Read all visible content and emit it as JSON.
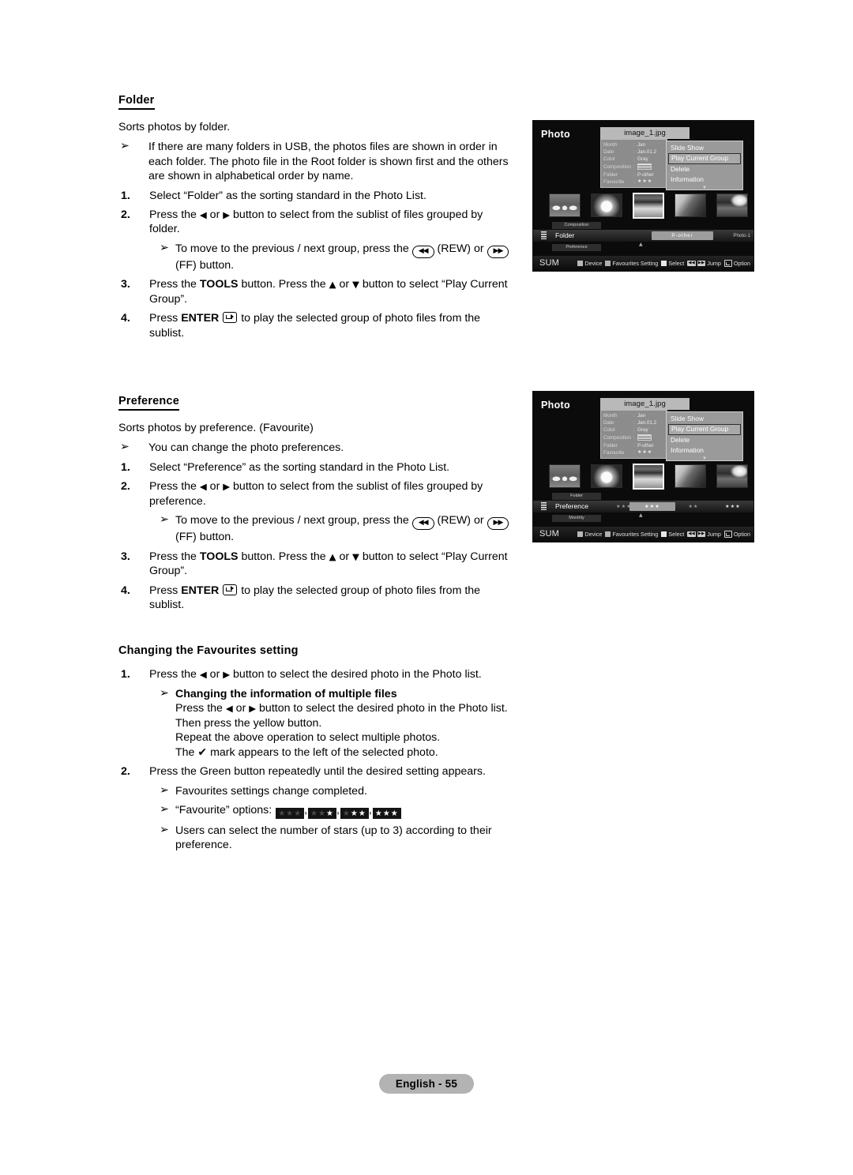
{
  "page": {
    "footer_label": "English - 55"
  },
  "folder_section": {
    "heading": "Folder",
    "lead": "Sorts photos by folder.",
    "note": "If there are many folders in USB, the photos files are shown in order in each folder. The photo file in the Root folder is shown first and the others are shown in alphabetical order by name.",
    "step1_num": "1.",
    "step1": "Select “Folder” as the sorting standard in the Photo List.",
    "step2_num": "2.",
    "step2_a": "Press the ",
    "step2_b": " or ",
    "step2_c": " button to select from the sublist of files grouped by folder.",
    "substep_a": "To move to the previous / next group, press the ",
    "substep_rew": "(REW) or ",
    "substep_ff": "(FF) button.",
    "step3_num": "3.",
    "step3_a": "Press the ",
    "step3_tools": "TOOLS",
    "step3_b": " button. Press the ",
    "step3_c": " or ",
    "step3_d": " button to select “Play Current Group”.",
    "step4_num": "4.",
    "step4_a": "Press ",
    "step4_enter": "ENTER",
    "step4_b": " to play the selected group of photo files from the sublist."
  },
  "preference_section": {
    "heading": "Preference",
    "lead": "Sorts photos by preference. (Favourite)",
    "note": "You can change the photo preferences.",
    "step1_num": "1.",
    "step1": "Select “Preference” as the sorting standard in the Photo List.",
    "step2_num": "2.",
    "step2_a": "Press the ",
    "step2_b": " or ",
    "step2_c": " button to select from the sublist of files grouped by preference.",
    "substep_a": "To move to the previous / next group, press the ",
    "substep_rew": "(REW) or ",
    "substep_ff": "(FF) button.",
    "step3_num": "3.",
    "step3_a": "Press the ",
    "step3_tools": "TOOLS",
    "step3_b": " button. Press the ",
    "step3_c": " or ",
    "step3_d": " button to select “Play Current Group”.",
    "step4_num": "4.",
    "step4_a": "Press ",
    "step4_enter": "ENTER",
    "step4_b": " to play the selected group of photo files from the sublist."
  },
  "favourites_section": {
    "heading": "Changing the Favourites setting",
    "step1_num": "1.",
    "step1_a": "Press the ",
    "step1_b": " or ",
    "step1_c": " button to select the desired photo in the Photo list.",
    "sub_heading": "Changing the information of multiple files",
    "sub_line1_a": "Press the ",
    "sub_line1_b": " or ",
    "sub_line1_c": " button to select the desired photo in the Photo list.",
    "sub_line2": "Then press the yellow button.",
    "sub_line3": "Repeat the above operation to select multiple photos.",
    "sub_line4_a": "The ",
    "sub_line4_b": " mark appears to the left of the selected photo.",
    "step2_num": "2.",
    "step2": "Press the Green button repeatedly until the desired setting appears.",
    "note1": "Favourites settings change completed.",
    "note2_label": "“Favourite” options:",
    "fav_options": [
      {
        "filled": 0,
        "total": 3
      },
      {
        "filled": 1,
        "total": 3
      },
      {
        "filled": 2,
        "total": 3
      },
      {
        "filled": 3,
        "total": 3
      }
    ],
    "note3": "Users can select the number of stars (up to 3) according to their preference."
  },
  "tv_screens": [
    {
      "id": "folder-screen",
      "title": "Photo",
      "file_name": "image_1.jpg",
      "info": [
        {
          "key": "Month",
          "sep": ":",
          "value": "Jan"
        },
        {
          "key": "Date",
          "sep": ":",
          "value": "Jan.01.2"
        },
        {
          "key": "Color",
          "sep": ":",
          "value": "Gray"
        },
        {
          "key": "Composition",
          "sep": ":",
          "value": ""
        },
        {
          "key": "Folder",
          "sep": ":",
          "value": "P-other"
        },
        {
          "key": "Favourite",
          "sep": ":",
          "value": "★★★"
        }
      ],
      "menu": {
        "items": [
          "Slide Show",
          "Play Current Group",
          "Delete",
          "Information"
        ],
        "selected": "Play Current Group",
        "more_glyph": "▼"
      },
      "sortbar": {
        "above_label": "Composition",
        "current_label": "Folder",
        "below_label": "Preference",
        "cells": [
          {
            "text": "",
            "highlight": false
          },
          {
            "text": "P-other",
            "highlight": true
          },
          {
            "text": "",
            "highlight": false
          }
        ],
        "right_label": "Photo-1",
        "caret": "▲"
      },
      "footer": {
        "sum": "SUM",
        "keys": [
          {
            "swatch": "red",
            "label": "Device"
          },
          {
            "swatch": "green",
            "label": "Favourites Setting"
          },
          {
            "swatch": "yellow",
            "label": "Select"
          },
          {
            "swatch": "jump",
            "label": "Jump"
          },
          {
            "swatch": "option",
            "label": "Option"
          }
        ]
      }
    },
    {
      "id": "preference-screen",
      "title": "Photo",
      "file_name": "image_1.jpg",
      "info": [
        {
          "key": "Month",
          "sep": ":",
          "value": "Jan"
        },
        {
          "key": "Date",
          "sep": ":",
          "value": "Jan.01.2"
        },
        {
          "key": "Color",
          "sep": ":",
          "value": "Gray"
        },
        {
          "key": "Composition",
          "sep": ":",
          "value": ""
        },
        {
          "key": "Folder",
          "sep": ":",
          "value": "P-other"
        },
        {
          "key": "Favourite",
          "sep": ":",
          "value": "★★★"
        }
      ],
      "menu": {
        "items": [
          "Slide Show",
          "Play Current Group",
          "Delete",
          "Information"
        ],
        "selected": "Play Current Group",
        "more_glyph": "▼"
      },
      "sortbar": {
        "above_label": "Folder",
        "current_label": "Preference",
        "below_label": "Monthly",
        "cells": [
          {
            "text": "★★★",
            "highlight": false
          },
          {
            "text": "★★★",
            "highlight": true
          },
          {
            "text": "★★",
            "highlight": false
          },
          {
            "text": "★★★",
            "highlight": false
          }
        ],
        "right_label": "",
        "caret": "▲"
      },
      "footer": {
        "sum": "SUM",
        "keys": [
          {
            "swatch": "red",
            "label": "Device"
          },
          {
            "swatch": "green",
            "label": "Favourites Setting"
          },
          {
            "swatch": "yellow",
            "label": "Select"
          },
          {
            "swatch": "jump",
            "label": "Jump"
          },
          {
            "swatch": "option",
            "label": "Option"
          }
        ]
      }
    }
  ],
  "glyphs": {
    "bullet_arrow": "➢",
    "left_tri": "◀",
    "right_tri": "▶",
    "up_tri": "▲",
    "down_tri": "▼",
    "check": "✔",
    "rew": "◀◀",
    "ff": "▶▶"
  }
}
